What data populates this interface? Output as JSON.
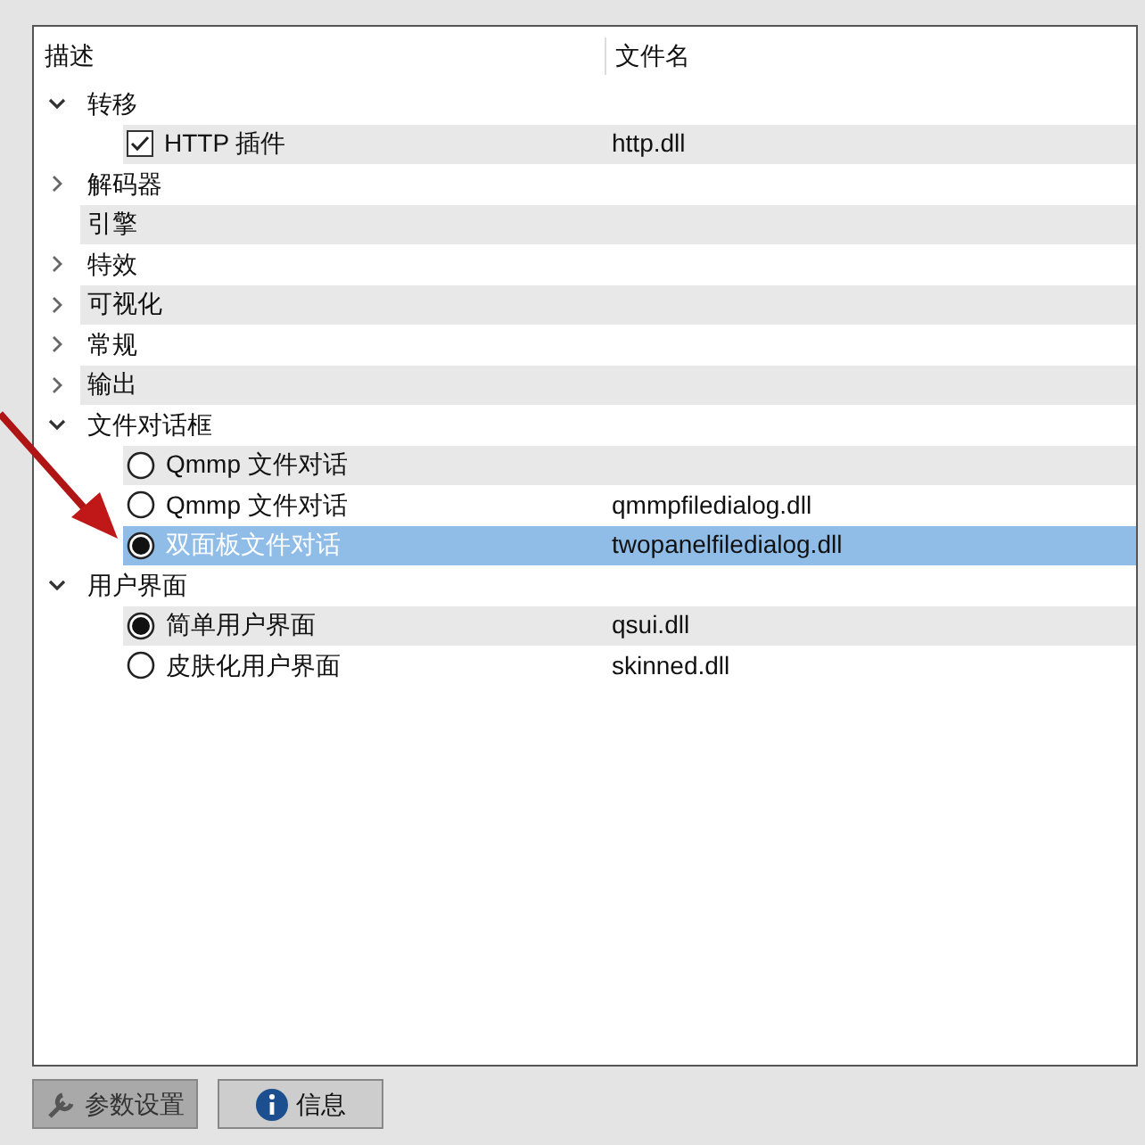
{
  "columns": [
    "描述",
    "文件名"
  ],
  "groups": [
    {
      "label": "转移",
      "kind": "branch",
      "expanded": true,
      "children": [
        {
          "label": "HTTP 插件",
          "file": "http.dll",
          "kind": "checkbox",
          "checked": true,
          "selected": false
        }
      ]
    },
    {
      "label": "解码器",
      "kind": "branch",
      "expanded": false
    },
    {
      "label": "引擎",
      "kind": "leaf"
    },
    {
      "label": "特效",
      "kind": "branch",
      "expanded": false
    },
    {
      "label": "可视化",
      "kind": "branch",
      "expanded": false
    },
    {
      "label": "常规",
      "kind": "branch",
      "expanded": false
    },
    {
      "label": "输出",
      "kind": "branch",
      "expanded": false
    },
    {
      "label": "文件对话框",
      "kind": "branch",
      "expanded": true,
      "children": [
        {
          "label": "Qmmp 文件对话",
          "kind": "radio",
          "checked": false,
          "selected": false
        },
        {
          "label": "Qmmp 文件对话",
          "file": "qmmpfiledialog.dll",
          "kind": "radio",
          "checked": false,
          "selected": false
        },
        {
          "label": "双面板文件对话",
          "file": "twopanelfiledialog.dll",
          "kind": "radio",
          "checked": true,
          "selected": true
        }
      ]
    },
    {
      "label": "用户界面",
      "kind": "branch",
      "expanded": true,
      "children": [
        {
          "label": "简单用户界面",
          "file": "qsui.dll",
          "kind": "radio",
          "checked": true,
          "selected": false
        },
        {
          "label": "皮肤化用户界面",
          "file": "skinned.dll",
          "kind": "radio",
          "checked": false,
          "selected": false
        }
      ]
    }
  ],
  "buttons": [
    {
      "label": "参数设置",
      "kind": "wrench"
    },
    {
      "label": "信息",
      "kind": "info"
    }
  ]
}
